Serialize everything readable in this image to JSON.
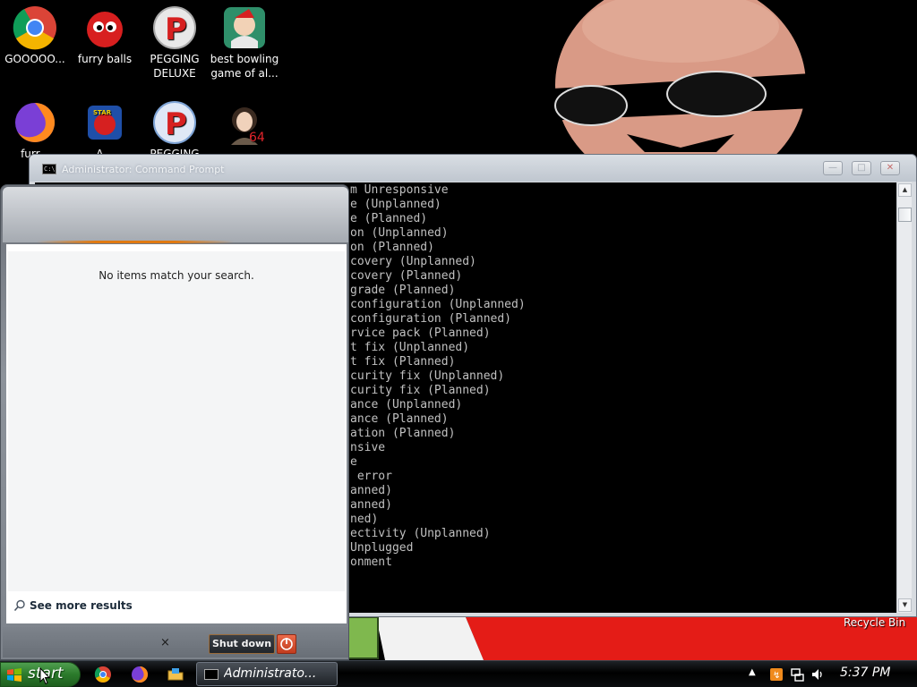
{
  "desktop": {
    "icons": [
      {
        "label": "GOOOOO..."
      },
      {
        "label": "furry balls"
      },
      {
        "label": "PEGGING DELUXE"
      },
      {
        "label": "best bowling game of al..."
      },
      {
        "label": "furr..."
      },
      {
        "label": "A..."
      },
      {
        "label": "PEGGING"
      },
      {
        "label": "..."
      }
    ],
    "recycle_bin_label": "Recycle Bin"
  },
  "cmd_window": {
    "title": "Administrator: Command Prompt",
    "console_lines": [
      "m Unresponsive",
      "e (Unplanned)",
      "e (Planned)",
      "on (Unplanned)",
      "on (Planned)",
      "covery (Unplanned)",
      "covery (Planned)",
      "grade (Planned)",
      "configuration (Unplanned)",
      "configuration (Planned)",
      "rvice pack (Planned)",
      "t fix (Unplanned)",
      "t fix (Planned)",
      "curity fix (Unplanned)",
      "curity fix (Planned)",
      "ance (Unplanned)",
      "ance (Planned)",
      "ation (Planned)",
      "nsive",
      "e",
      " error",
      "anned)",
      "anned)",
      "ned)",
      "ectivity (Unplanned)",
      "Unplugged",
      "onment"
    ]
  },
  "start_menu": {
    "no_results_text": "No items match your search.",
    "see_more_label": "See more results",
    "clear_label": "×",
    "shutdown_label": "Shut down"
  },
  "taskbar": {
    "start_label": "start",
    "task_cmd_label": "Administrato...",
    "clock": "5:37 PM"
  },
  "colors": {
    "start_green": "#2b7a2b",
    "console_bg": "#000000",
    "console_text": "#c0c0c0",
    "accent_orange": "#e07a12",
    "shutdown_red": "#d2482a"
  }
}
